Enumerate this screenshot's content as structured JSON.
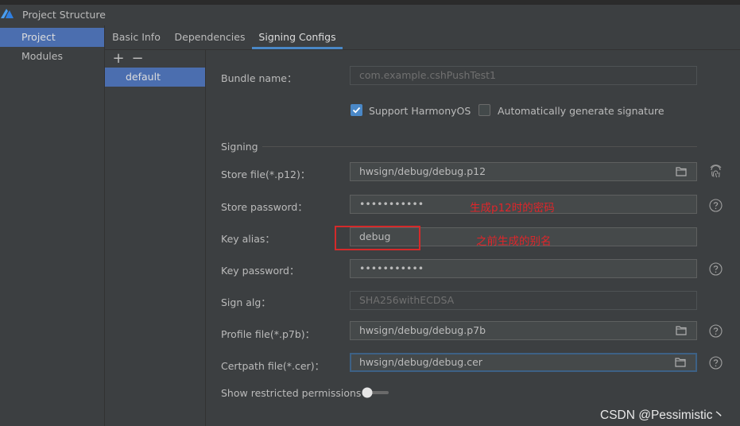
{
  "window": {
    "title": "Project Structure"
  },
  "left_nav": {
    "items": [
      {
        "label": "Project",
        "selected": true
      },
      {
        "label": "Modules",
        "selected": false
      }
    ]
  },
  "tabs": [
    {
      "label": "Basic Info",
      "active": false
    },
    {
      "label": "Dependencies",
      "active": false
    },
    {
      "label": "Signing Configs",
      "active": true
    }
  ],
  "config_list": {
    "add_label": "+",
    "remove_label": "−",
    "items": [
      {
        "label": "default",
        "selected": true
      }
    ]
  },
  "form": {
    "bundle_name": {
      "label": "Bundle name：",
      "placeholder": "com.example.cshPushTest1"
    },
    "support_harmonyos": {
      "label": "Support HarmonyOS",
      "checked": true
    },
    "auto_sign": {
      "label": "Automatically generate signature",
      "checked": false
    },
    "signing_section": "Signing",
    "store_file": {
      "label": "Store file(*.p12)：",
      "value": "hwsign/debug/debug.p12"
    },
    "store_password": {
      "label": "Store password：",
      "value": "•••••••••••"
    },
    "key_alias": {
      "label": "Key alias：",
      "value": "debug"
    },
    "key_password": {
      "label": "Key password：",
      "value": "•••••••••••"
    },
    "sign_alg": {
      "label": "Sign alg：",
      "placeholder": "SHA256withECDSA"
    },
    "profile_file": {
      "label": "Profile file(*.p7b)：",
      "value": "hwsign/debug/debug.p7b"
    },
    "certpath_file": {
      "label": "Certpath file(*.cer)：",
      "value": "hwsign/debug/debug.cer"
    },
    "show_restricted": {
      "label": "Show restricted permissions",
      "enabled": false
    }
  },
  "annotations": {
    "store_password_note": "生成p12时的密码",
    "key_alias_note": "之前生成的别名"
  },
  "watermark": "CSDN @Pessimistic丶",
  "colors": {
    "accent": "#4a88c7",
    "selection": "#4b6eaf",
    "annotation_red": "#e0252a"
  }
}
